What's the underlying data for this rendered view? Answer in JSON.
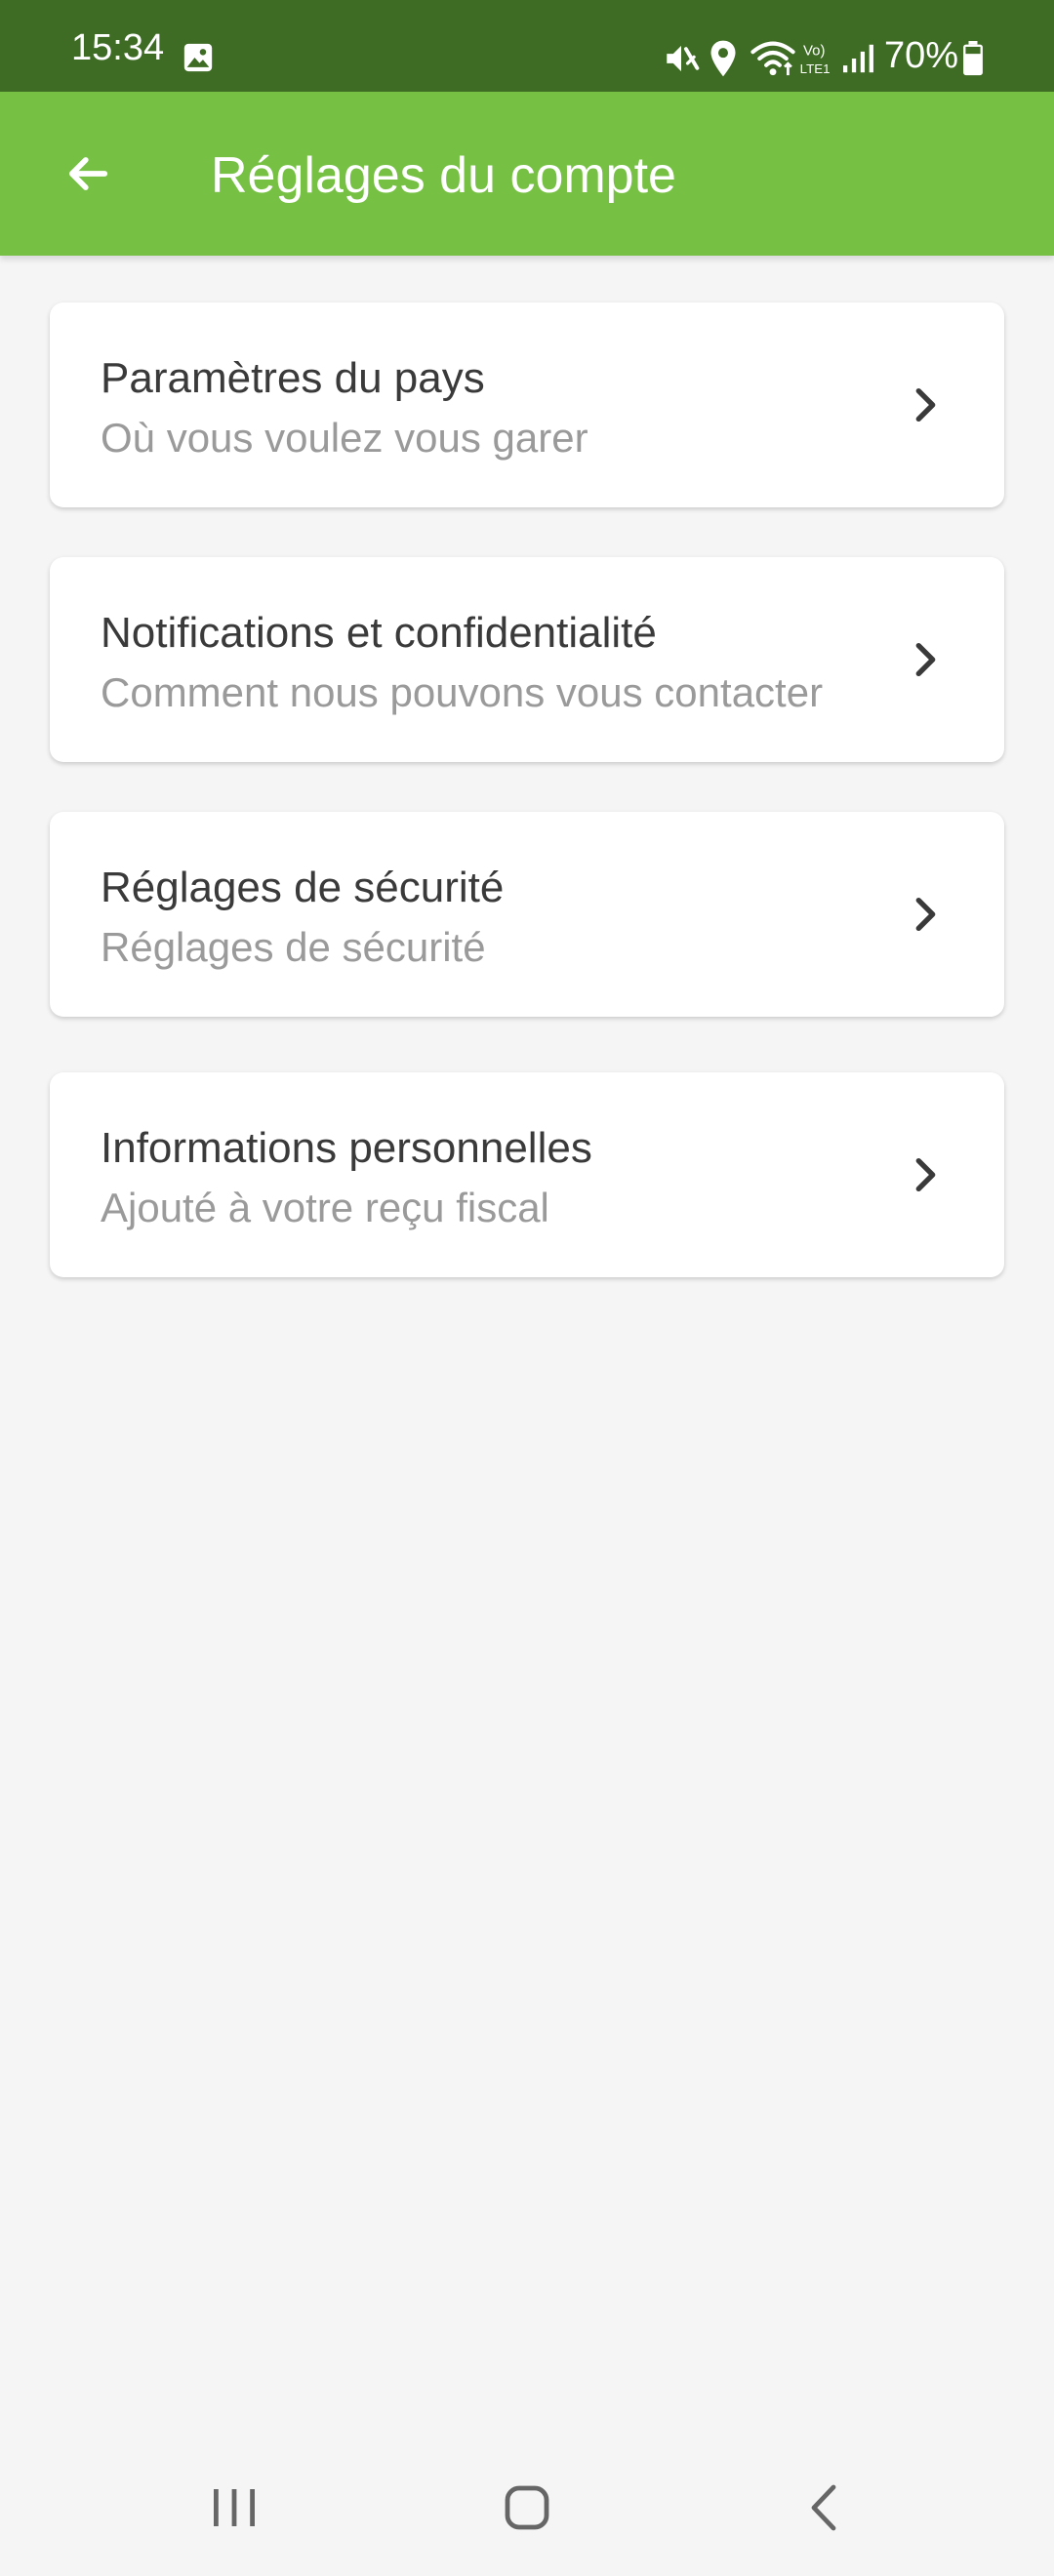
{
  "status_bar": {
    "time": "15:34",
    "battery": "70%",
    "icons": [
      "image-icon",
      "mute-icon",
      "location-icon",
      "wifi-icon",
      "volte-icon",
      "signal-icon",
      "battery-icon"
    ]
  },
  "app_bar": {
    "title": "Réglages du compte",
    "back_icon": "arrow-left-icon"
  },
  "settings": {
    "items": [
      {
        "title": "Paramètres du pays",
        "subtitle": "Où vous voulez vous garer"
      },
      {
        "title": "Notifications et confidentialité",
        "subtitle": "Comment nous pouvons vous contacter"
      },
      {
        "title": "Réglages de sécurité",
        "subtitle": "Réglages de sécurité"
      },
      {
        "title": "Informations personnelles",
        "subtitle": "Ajouté à votre reçu fiscal"
      }
    ]
  },
  "nav_bar": {
    "icons": [
      "recent-apps-icon",
      "home-icon",
      "back-icon"
    ]
  },
  "colors": {
    "status_bar": "#3e6c24",
    "app_bar": "#76c043",
    "background": "#f5f5f5",
    "card": "#ffffff",
    "title_text": "#3a3a3a",
    "subtitle_text": "#9a9a9a"
  }
}
